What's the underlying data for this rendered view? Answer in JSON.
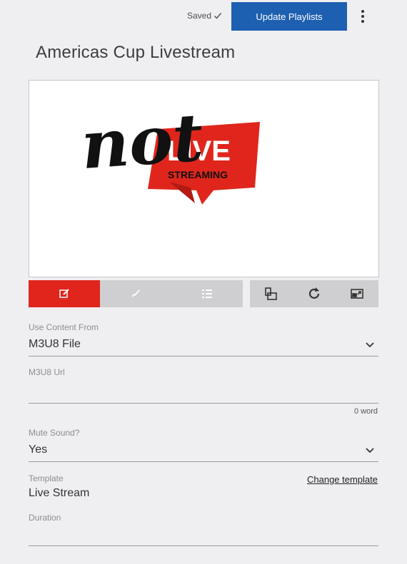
{
  "header": {
    "saved_label": "Saved",
    "update_button_label": "Update Playlists"
  },
  "page": {
    "title": "Americas Cup Livestream"
  },
  "preview": {
    "logo_word": "not",
    "banner_title": "LIVE",
    "banner_subtitle": "STREAMING",
    "banner_color": "#e0261c"
  },
  "toolbar": {
    "active_color": "#e0261c",
    "left_buttons": [
      "edit-icon",
      "brush-icon",
      "list-icon"
    ],
    "right_buttons": [
      "layers-icon",
      "refresh-icon",
      "window-icon"
    ]
  },
  "form": {
    "content_source": {
      "label": "Use Content From",
      "value": "M3U8 File"
    },
    "m3u8_url": {
      "label": "M3U8 Url",
      "value": "",
      "word_count": "0 word"
    },
    "mute_sound": {
      "label": "Mute Sound?",
      "value": "Yes"
    },
    "template": {
      "label": "Template",
      "value": "Live Stream",
      "change_link": "Change template"
    },
    "duration": {
      "label": "Duration",
      "value": ""
    }
  }
}
